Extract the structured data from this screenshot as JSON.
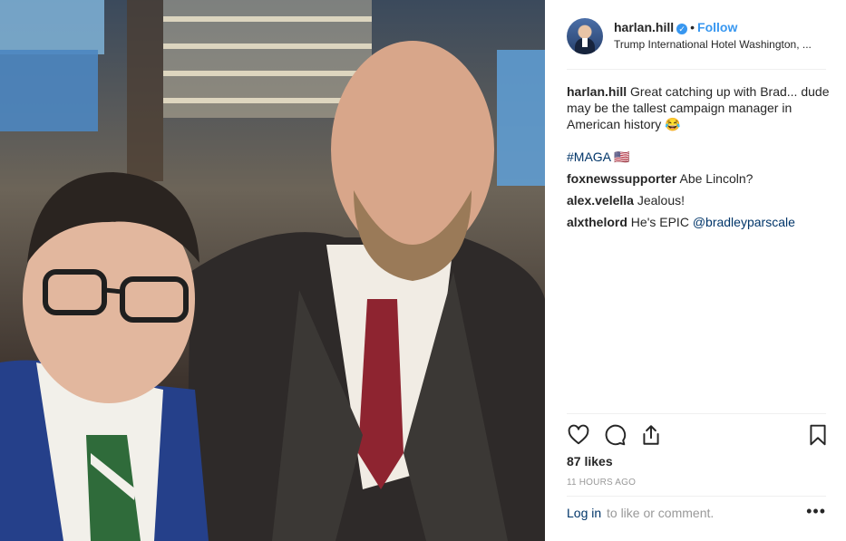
{
  "post": {
    "username": "harlan.hill",
    "verified_icon": "verified-badge-icon",
    "separator": "•",
    "follow_label": "Follow",
    "location": "Trump International Hotel Washington, ..."
  },
  "comments": [
    {
      "user": "harlan.hill",
      "text": "Great catching up with Brad... dude may be the tallest campaign manager in American history 😂"
    },
    {
      "user": "",
      "text": "#MAGA 🇺🇸"
    },
    {
      "user": "foxnewssupporter",
      "text": "Abe Lincoln?"
    },
    {
      "user": "alex.velella",
      "text": "Jealous!"
    },
    {
      "user": "alxthelord",
      "text": "He's EPIC ",
      "mention": "@bradleyparscale"
    }
  ],
  "actions": {
    "icons": [
      "heart-icon",
      "comment-icon",
      "share-icon",
      "bookmark-icon"
    ],
    "likes": "87 likes",
    "time": "11 HOURS AGO",
    "login_link": "Log in",
    "login_rest": "to like or comment.",
    "more": "•••"
  },
  "colors": {
    "accent": "#3897f0",
    "link": "#003569",
    "muted": "#999999",
    "text": "#262626"
  }
}
